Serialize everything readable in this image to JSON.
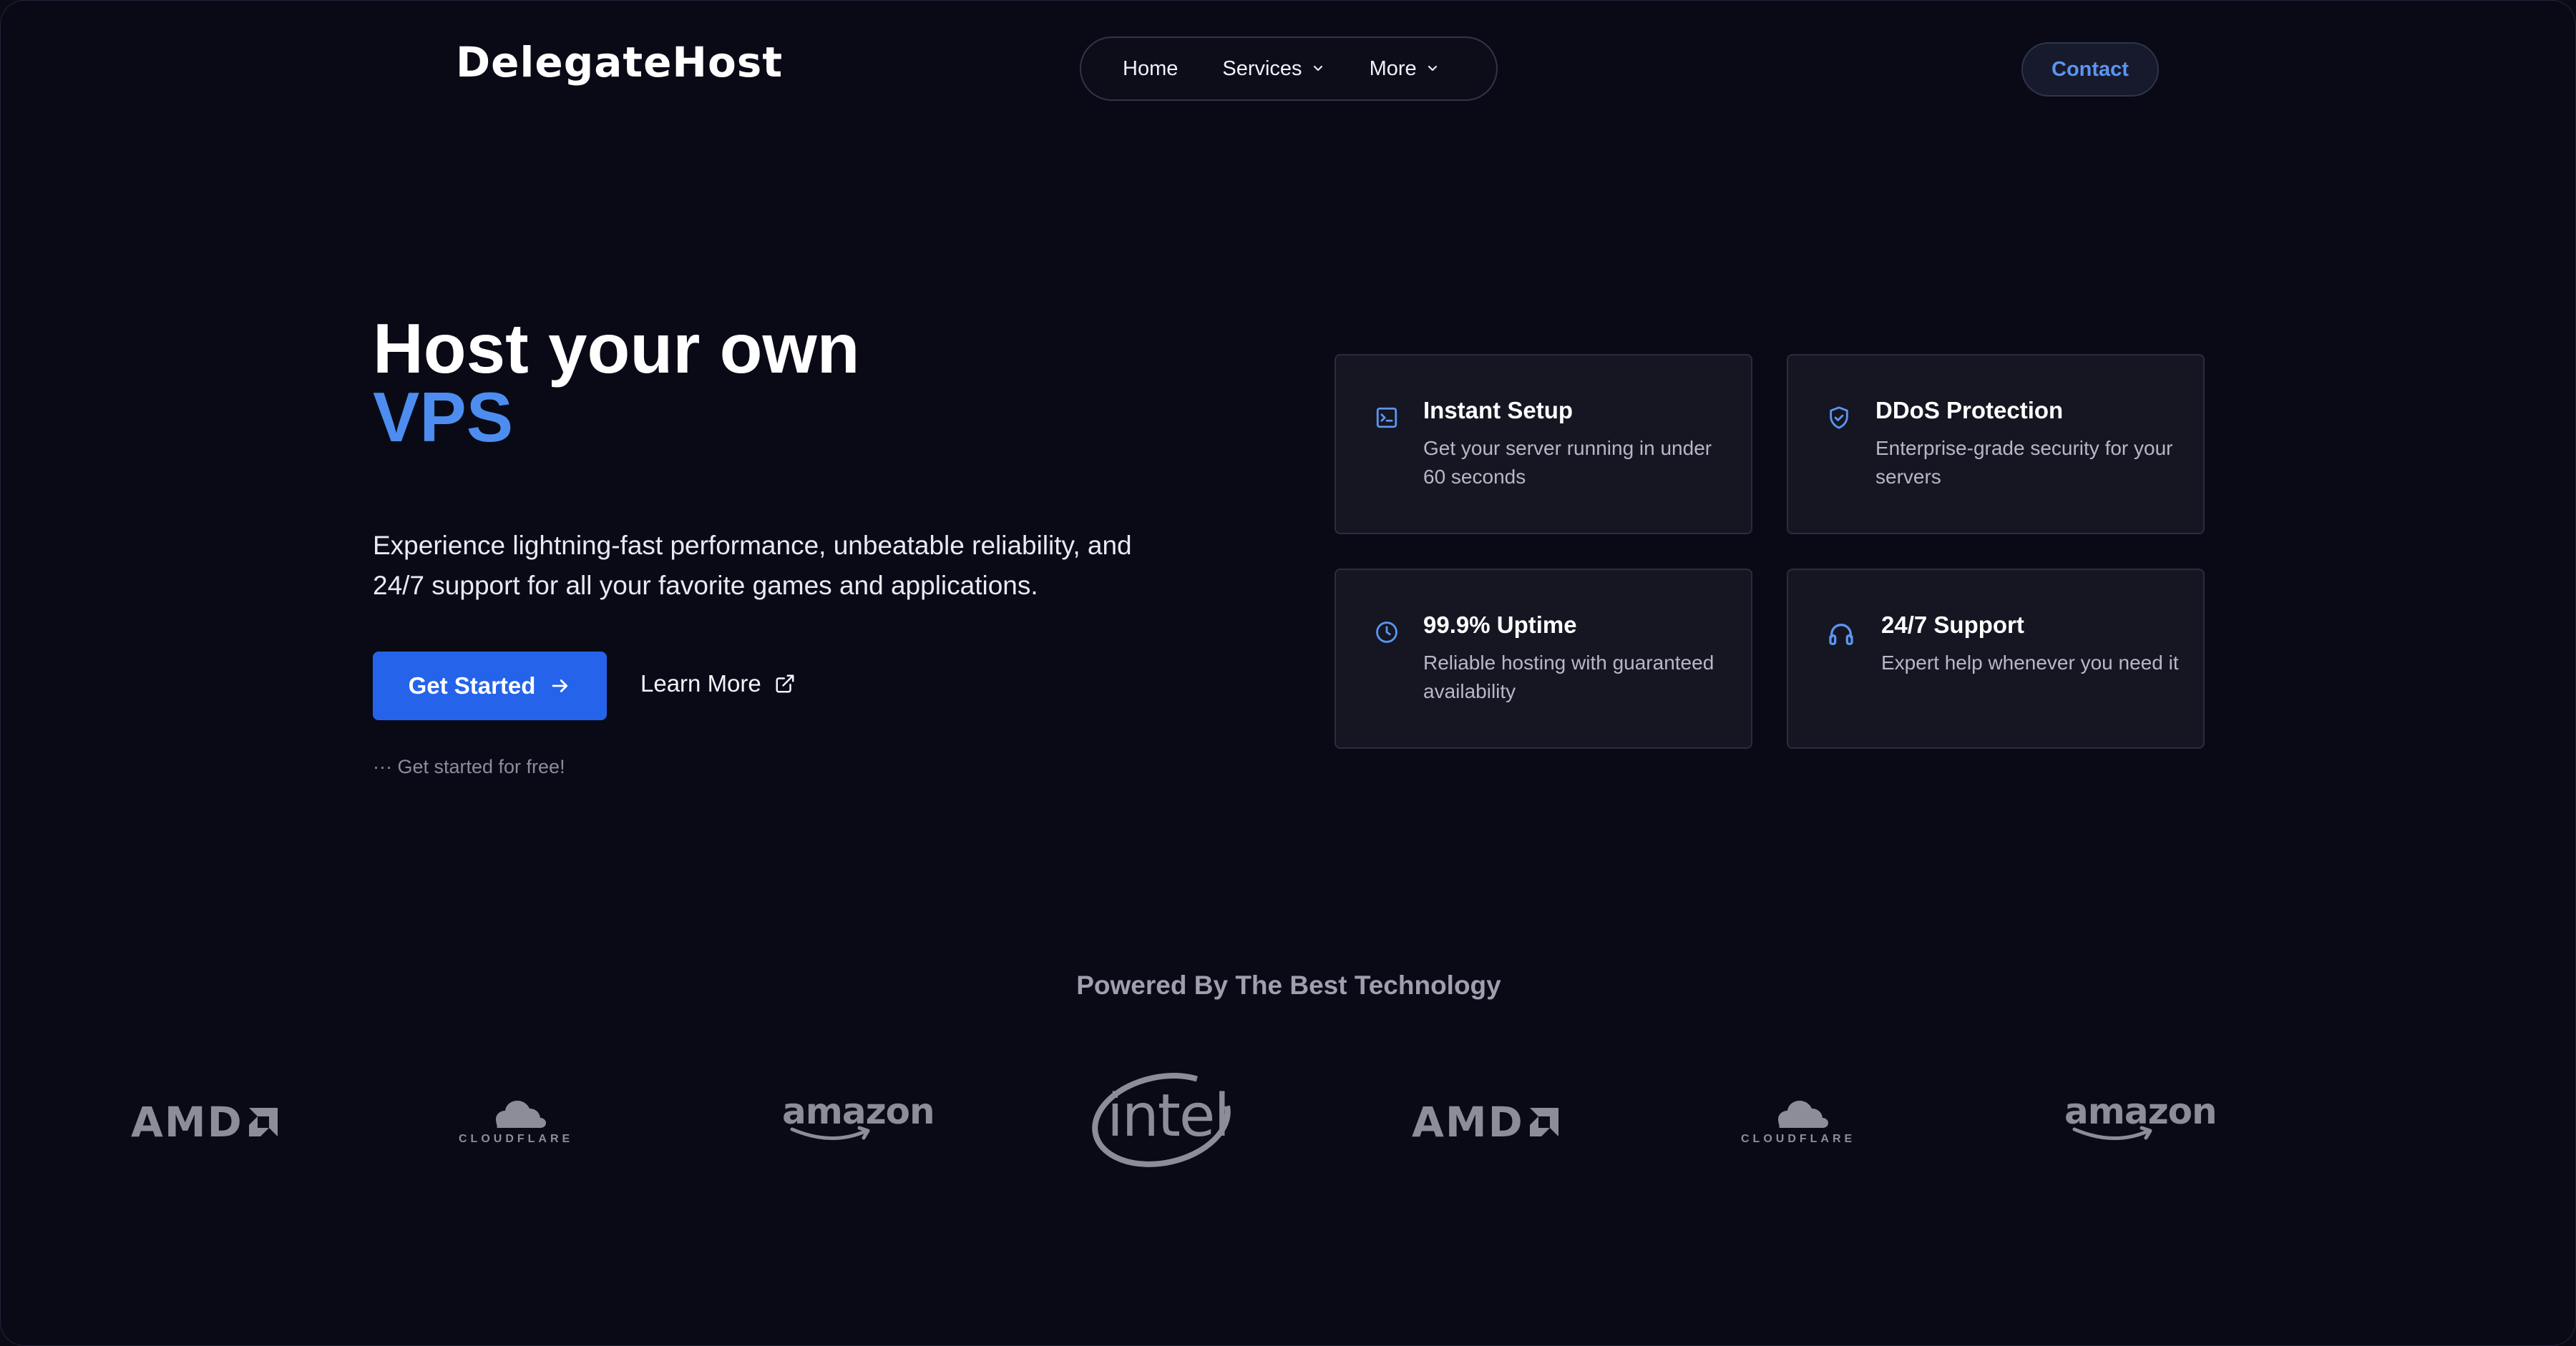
{
  "brand": "DelegateHost",
  "nav": {
    "items": [
      {
        "label": "Home",
        "dropdown": false
      },
      {
        "label": "Services",
        "dropdown": true
      },
      {
        "label": "More",
        "dropdown": true
      }
    ],
    "contact_label": "Contact"
  },
  "hero": {
    "title_line1": "Host your own",
    "title_line2": "VPS",
    "subtitle": "Experience lightning-fast performance, unbeatable reliability, and 24/7 support for all your favorite games and applications.",
    "cta_primary": "Get Started",
    "cta_secondary": "Learn More",
    "note": "··· Get started for free!"
  },
  "features": [
    {
      "icon": "terminal-icon",
      "title": "Instant Setup",
      "desc": "Get your server running in under 60 seconds"
    },
    {
      "icon": "shield-check-icon",
      "title": "DDoS Protection",
      "desc": "Enterprise-grade security for your servers"
    },
    {
      "icon": "clock-icon",
      "title": "99.9% Uptime",
      "desc": "Reliable hosting with guaranteed availability"
    },
    {
      "icon": "headset-icon",
      "title": "24/7 Support",
      "desc": "Expert help whenever you need it"
    }
  ],
  "tech": {
    "title": "Powered By The Best Technology",
    "logos": [
      "AMD",
      "CLOUDFLARE",
      "amazon",
      "intel",
      "AMD",
      "CLOUDFLARE",
      "amazon"
    ]
  },
  "colors": {
    "background": "#0a0a17",
    "accent": "#4e8df0",
    "primary_button": "#2563eb"
  }
}
